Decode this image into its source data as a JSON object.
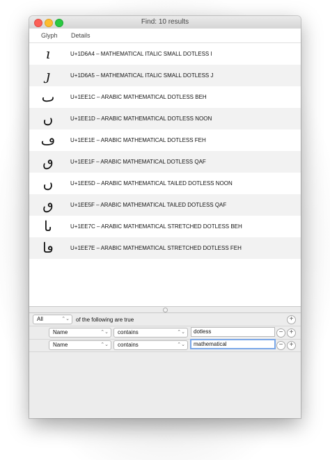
{
  "window": {
    "title": "Find: 10 results"
  },
  "columns": {
    "glyph": "Glyph",
    "details": "Details"
  },
  "results": [
    {
      "glyph": "𝚤",
      "details": "U+1D6A4 – MATHEMATICAL ITALIC SMALL DOTLESS I"
    },
    {
      "glyph": "𝚥",
      "details": "U+1D6A5 – MATHEMATICAL ITALIC SMALL DOTLESS J"
    },
    {
      "glyph": "ٮ",
      "details": "U+1EE1C – ARABIC MATHEMATICAL DOTLESS BEH"
    },
    {
      "glyph": "ں",
      "details": "U+1EE1D – ARABIC MATHEMATICAL DOTLESS NOON"
    },
    {
      "glyph": "ڡ",
      "details": "U+1EE1E – ARABIC MATHEMATICAL DOTLESS FEH"
    },
    {
      "glyph": "ٯ",
      "details": "U+1EE1F – ARABIC MATHEMATICAL DOTLESS QAF"
    },
    {
      "glyph": "ں",
      "details": "U+1EE5D – ARABIC MATHEMATICAL TAILED DOTLESS NOON"
    },
    {
      "glyph": "ٯ",
      "details": "U+1EE5F – ARABIC MATHEMATICAL TAILED DOTLESS QAF"
    },
    {
      "glyph": "ٮا",
      "details": "U+1EE7C – ARABIC MATHEMATICAL STRETCHED DOTLESS BEH"
    },
    {
      "glyph": "ڡا",
      "details": "U+1EE7E – ARABIC MATHEMATICAL STRETCHED DOTLESS FEH"
    }
  ],
  "predicate_editor": {
    "match_selector": "All",
    "match_label": "of the following are true",
    "rows": [
      {
        "field": "Name",
        "operator": "contains",
        "value": "dotless"
      },
      {
        "field": "Name",
        "operator": "contains",
        "value": "mathematical"
      }
    ],
    "add_symbol": "+",
    "remove_symbol": "−"
  },
  "icons": {
    "popup_arrows": "⌃⌄",
    "splitter": "splitter-handle-icon"
  }
}
